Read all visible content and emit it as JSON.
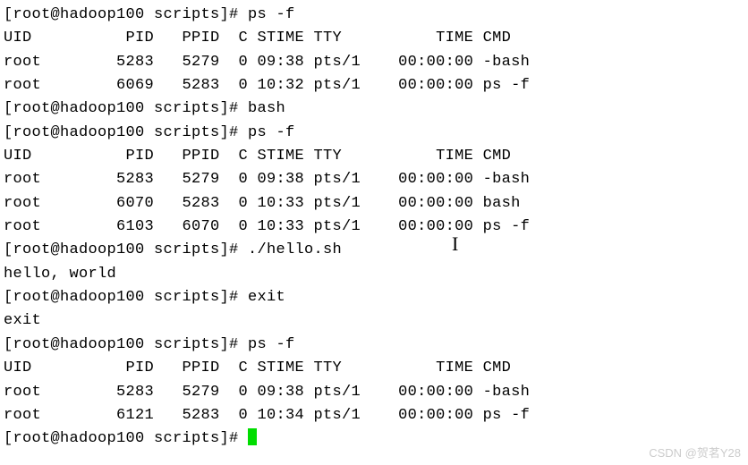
{
  "prompt": "[root@hadoop100 scripts]# ",
  "cmd_ps": "ps -f",
  "cmd_bash": "bash",
  "cmd_hello": "./hello.sh",
  "cmd_exit": "exit",
  "header": "UID          PID   PPID  C STIME TTY          TIME CMD",
  "rows1": {
    "r0": "root        5283   5279  0 09:38 pts/1    00:00:00 -bash",
    "r1": "root        6069   5283  0 10:32 pts/1    00:00:00 ps -f"
  },
  "rows2": {
    "r0": "root        5283   5279  0 09:38 pts/1    00:00:00 -bash",
    "r1": "root        6070   5283  0 10:33 pts/1    00:00:00 bash",
    "r2": "root        6103   6070  0 10:33 pts/1    00:00:00 ps -f"
  },
  "hello_out": "hello, world",
  "exit_out": "exit",
  "rows3": {
    "r0": "root        5283   5279  0 09:38 pts/1    00:00:00 -bash",
    "r1": "root        6121   5283  0 10:34 pts/1    00:00:00 ps -f"
  },
  "watermark": "CSDN @贺茗Y28"
}
